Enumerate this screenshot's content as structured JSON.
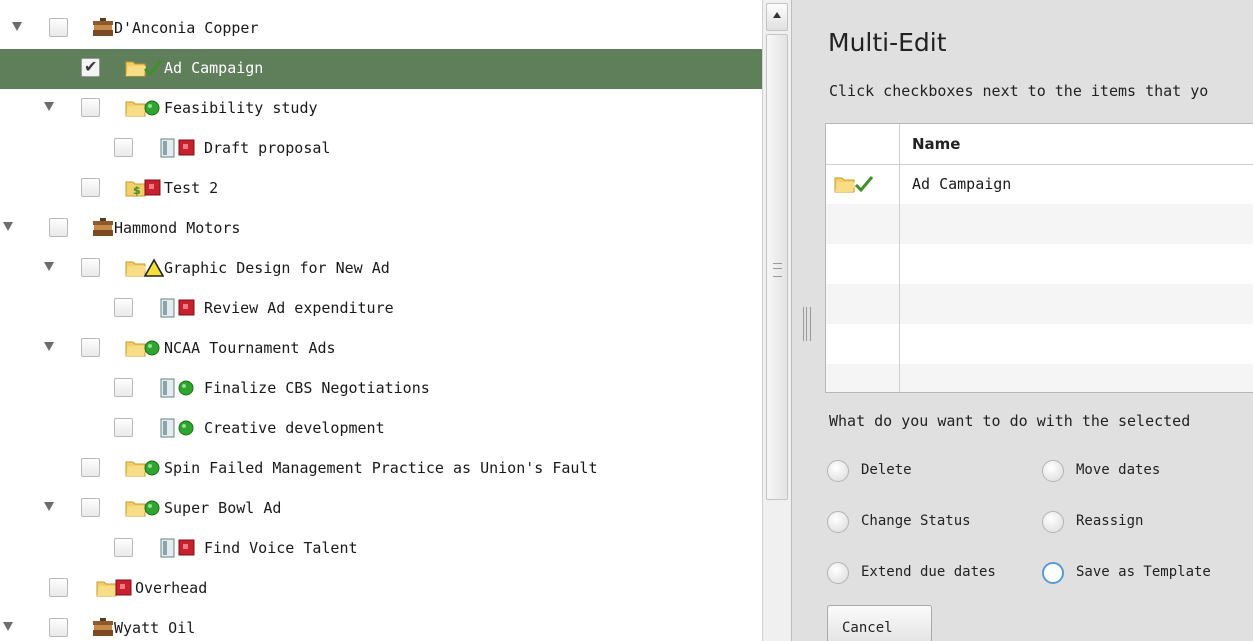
{
  "tree": {
    "rows": [
      {
        "label": "D'Anconia Copper",
        "icon": "client-briefcase-icon",
        "status": "",
        "expanded": true,
        "checked": false,
        "selected": false
      },
      {
        "label": "Ad Campaign",
        "icon": "folder-icon",
        "status": "check-complete-icon",
        "expanded": false,
        "checked": true,
        "selected": true
      },
      {
        "label": "Feasibility study",
        "icon": "folder-icon",
        "status": "green-status-icon",
        "expanded": true,
        "checked": false,
        "selected": false
      },
      {
        "label": "Draft proposal",
        "icon": "task-document-icon",
        "status": "red-status-icon",
        "expanded": false,
        "checked": false,
        "selected": false
      },
      {
        "label": "Test 2",
        "icon": "money-folder-icon",
        "status": "red-status-icon",
        "expanded": false,
        "checked": false,
        "selected": false
      },
      {
        "label": "Hammond Motors",
        "icon": "client-briefcase-icon",
        "status": "",
        "expanded": true,
        "checked": false,
        "selected": false
      },
      {
        "label": "Graphic Design for New Ad",
        "icon": "folder-icon",
        "status": "warning-triangle-icon",
        "expanded": true,
        "checked": false,
        "selected": false
      },
      {
        "label": "Review Ad expenditure",
        "icon": "task-document-icon",
        "status": "red-status-icon",
        "expanded": false,
        "checked": false,
        "selected": false
      },
      {
        "label": "NCAA Tournament Ads",
        "icon": "folder-icon",
        "status": "green-status-icon",
        "expanded": true,
        "checked": false,
        "selected": false
      },
      {
        "label": "Finalize CBS Negotiations",
        "icon": "task-document-icon",
        "status": "green-status-icon",
        "expanded": false,
        "checked": false,
        "selected": false
      },
      {
        "label": "Creative development",
        "icon": "task-document-icon",
        "status": "green-status-icon",
        "expanded": false,
        "checked": false,
        "selected": false
      },
      {
        "label": "Spin Failed Management Practice as Union's Fault",
        "icon": "folder-icon",
        "status": "green-status-icon",
        "expanded": false,
        "checked": false,
        "selected": false
      },
      {
        "label": "Super Bowl Ad",
        "icon": "folder-icon",
        "status": "green-status-icon",
        "expanded": true,
        "checked": false,
        "selected": false
      },
      {
        "label": "Find Voice Talent",
        "icon": "task-document-icon",
        "status": "red-status-icon",
        "expanded": false,
        "checked": false,
        "selected": false
      },
      {
        "label": "Overhead",
        "icon": "folder-icon",
        "status": "red-status-icon",
        "expanded": false,
        "checked": false,
        "selected": false
      },
      {
        "label": "Wyatt Oil",
        "icon": "client-briefcase-icon",
        "status": "",
        "expanded": true,
        "checked": false,
        "selected": false
      }
    ]
  },
  "panel": {
    "title": "Multi-Edit",
    "instruction": "Click checkboxes next to the items that yo",
    "grid": {
      "name_header": "Name",
      "rows": [
        {
          "name": "Ad Campaign",
          "icon": "folder-icon",
          "status": "check-complete-icon"
        }
      ]
    },
    "question": "What do you want to do with the selected",
    "actions": [
      {
        "label": "Delete",
        "selected": false
      },
      {
        "label": "Move dates",
        "selected": false
      },
      {
        "label": "Change Status",
        "selected": false
      },
      {
        "label": "Reassign",
        "selected": false
      },
      {
        "label": "Extend due dates",
        "selected": false
      },
      {
        "label": "Save as Template",
        "selected": false,
        "focused": true
      }
    ],
    "cancel_label": "Cancel"
  },
  "colors": {
    "selection": "#5f7f5b",
    "panel_bg": "#e0e0e0",
    "focus_ring": "#5a9bd6",
    "status_green": "#2fa52f",
    "status_red": "#c8202e",
    "folder_yellow": "#f0c85a"
  }
}
